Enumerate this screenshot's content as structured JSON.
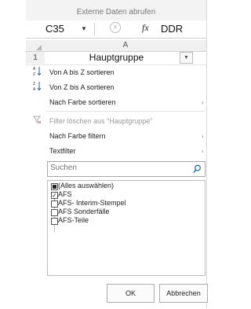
{
  "ribbon": {
    "group_label": "Externe Daten abrufen"
  },
  "formula_bar": {
    "name_box": "C35",
    "fx_label": "fx",
    "formula_value": "DDR"
  },
  "sheet": {
    "column_header": "A",
    "row_number": "1",
    "cell_value": "Hauptgruppe"
  },
  "menu": {
    "sort_az": "Von A bis Z sortieren",
    "sort_za": "Von Z bis A sortieren",
    "sort_color": "Nach Farbe sortieren",
    "clear_filter": "Filter löschen aus \"Hauptgruppe\"",
    "filter_color": "Nach Farbe filtern",
    "text_filter": "Textfilter"
  },
  "search": {
    "placeholder": "Suchen"
  },
  "filter_list": [
    {
      "label": "(Alles auswählen)",
      "state": "indeterminate"
    },
    {
      "label": "AFS",
      "state": "checked"
    },
    {
      "label": "AFS- Interim-Stempel",
      "state": "unchecked"
    },
    {
      "label": "AFS Sonderfälle",
      "state": "unchecked"
    },
    {
      "label": "AFS-Teile",
      "state": "unchecked"
    }
  ],
  "buttons": {
    "ok": "OK",
    "cancel": "Abbrechen"
  },
  "icons": {
    "sort_az": "sort-ascending-icon",
    "sort_za": "sort-descending-icon",
    "clear_filter": "clear-filter-icon",
    "search": "search-icon",
    "dropdown": "filter-dropdown-icon"
  }
}
